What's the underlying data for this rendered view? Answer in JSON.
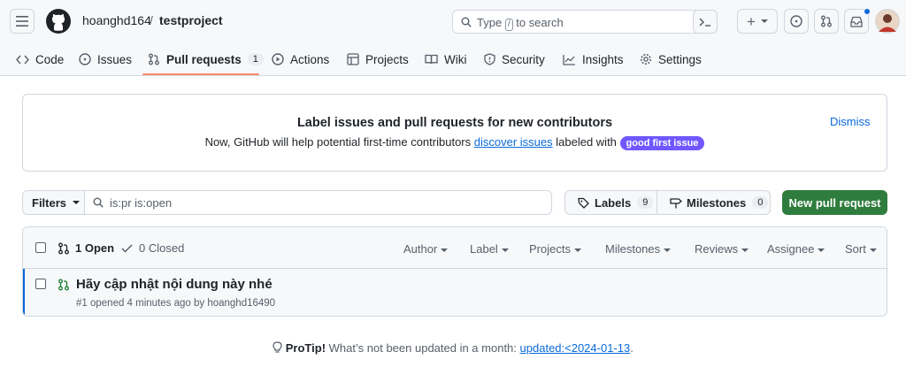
{
  "header": {
    "owner": "hoanghd164",
    "separator": "/",
    "repo": "testproject",
    "search_placeholder_prefix": "Type",
    "search_key": "/",
    "search_placeholder_suffix": "to search",
    "plus_label": "+",
    "avatar_color": "#c0392b"
  },
  "nav": {
    "code": "Code",
    "issues": "Issues",
    "pull_requests": "Pull requests",
    "pull_requests_count": "1",
    "actions": "Actions",
    "projects": "Projects",
    "wiki": "Wiki",
    "security": "Security",
    "insights": "Insights",
    "settings": "Settings"
  },
  "banner": {
    "title": "Label issues and pull requests for new contributors",
    "text_prefix": "Now, GitHub will help potential first-time contributors",
    "link": "discover issues",
    "text_suffix": "labeled with",
    "pill": "good first issue",
    "dismiss": "Dismiss"
  },
  "filters": {
    "filters_label": "Filters",
    "query": "is:pr is:open",
    "labels_label": "Labels",
    "labels_count": "9",
    "milestones_label": "Milestones",
    "milestones_count": "0",
    "new_pr": "New pull request"
  },
  "list": {
    "open_label": "1 Open",
    "closed_label": "0 Closed",
    "columns": [
      "Author",
      "Label",
      "Projects",
      "Milestones",
      "Reviews",
      "Assignee",
      "Sort"
    ],
    "items": [
      {
        "title": "Hãy cập nhật nội dung này nhé",
        "meta": "#1 opened 4 minutes ago by hoanghd16490"
      }
    ]
  },
  "protip": {
    "strong": "ProTip!",
    "text": "What’s not been updated in a month:",
    "link": "updated:<2024-01-13",
    "period": "."
  },
  "colors": {
    "accent_underline": "#fd8c73",
    "primary_button": "#2f7d3e",
    "link": "#0969da",
    "label_pill": "#7057ff",
    "open_pr_icon": "#1a7f37"
  }
}
